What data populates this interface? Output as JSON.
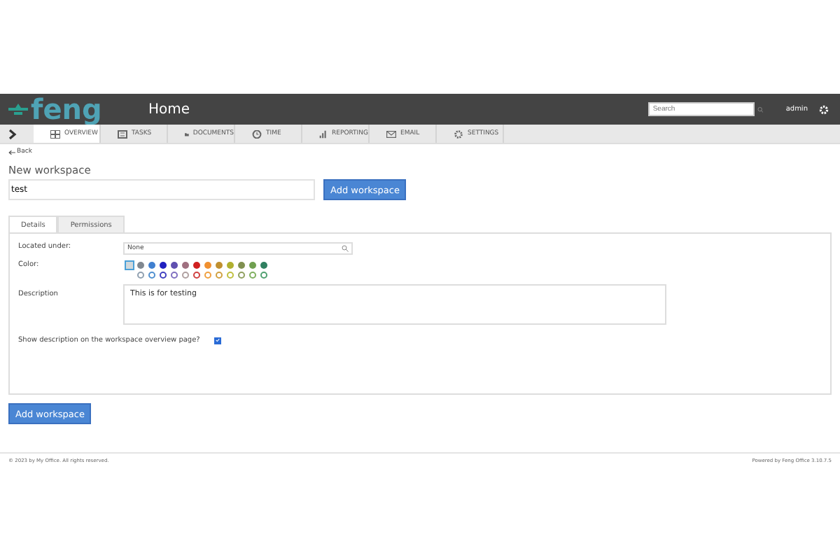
{
  "header": {
    "logo": "feng",
    "title": "Home",
    "search": {
      "placeholder": "Search"
    },
    "user": "admin"
  },
  "tabs": [
    {
      "label": "OVERVIEW",
      "selected": true
    },
    {
      "label": "TASKS",
      "selected": false
    },
    {
      "label": "DOCUMENTS",
      "selected": false
    },
    {
      "label": "TIME",
      "selected": false
    },
    {
      "label": "REPORTING",
      "selected": false
    },
    {
      "label": "EMAIL",
      "selected": false
    },
    {
      "label": "SETTINGS",
      "selected": false
    }
  ],
  "back": "Back",
  "heading": "New workspace",
  "name_field": {
    "value": "test"
  },
  "top_button": "Add workspace",
  "form_tabs": [
    {
      "label": "Details",
      "selected": true
    },
    {
      "label": "Permissions",
      "selected": false
    }
  ],
  "located_label": "Located under:",
  "located_value": "None",
  "color_label": "Color:",
  "colors": [
    {
      "color": "#d0d8dc",
      "filled": true,
      "selected": true
    },
    {
      "color": "#808890",
      "filled": true,
      "selected": false
    },
    {
      "color": "#4080d0",
      "filled": true,
      "selected": false
    },
    {
      "color": "#2020c0",
      "filled": true,
      "selected": false
    },
    {
      "color": "#6050b0",
      "filled": true,
      "selected": false
    },
    {
      "color": "#a07080",
      "filled": true,
      "selected": false
    },
    {
      "color": "#d02020",
      "filled": true,
      "selected": false
    },
    {
      "color": "#f09030",
      "filled": true,
      "selected": false
    },
    {
      "color": "#c09030",
      "filled": true,
      "selected": false
    },
    {
      "color": "#b0b030",
      "filled": true,
      "selected": false
    },
    {
      "color": "#809050",
      "filled": true,
      "selected": false
    },
    {
      "color": "#70a050",
      "filled": true,
      "selected": false
    },
    {
      "color": "#308060",
      "filled": true,
      "selected": false
    },
    {
      "color": "#90a0b0",
      "filled": false,
      "selected": false
    },
    {
      "color": "#5090d0",
      "filled": false,
      "selected": false
    },
    {
      "color": "#4040c0",
      "filled": false,
      "selected": false
    },
    {
      "color": "#8070c0",
      "filled": false,
      "selected": false
    },
    {
      "color": "#b0a0a0",
      "filled": false,
      "selected": false
    },
    {
      "color": "#d04040",
      "filled": false,
      "selected": false
    },
    {
      "color": "#f0a040",
      "filled": false,
      "selected": false
    },
    {
      "color": "#d0a040",
      "filled": false,
      "selected": false
    },
    {
      "color": "#c0c040",
      "filled": false,
      "selected": false
    },
    {
      "color": "#90a060",
      "filled": false,
      "selected": false
    },
    {
      "color": "#80b060",
      "filled": false,
      "selected": false
    },
    {
      "color": "#50a070",
      "filled": false,
      "selected": false
    }
  ],
  "description_label": "Description",
  "description_value": "This is for testing",
  "show_description": {
    "label": "Show description on the workspace overview page?",
    "checked": true
  },
  "bottom_button": "Add workspace",
  "footer": {
    "left": "© 2023 by My Office. All rights reserved.",
    "right": "Powered by Feng Office 3.10.7.5"
  }
}
